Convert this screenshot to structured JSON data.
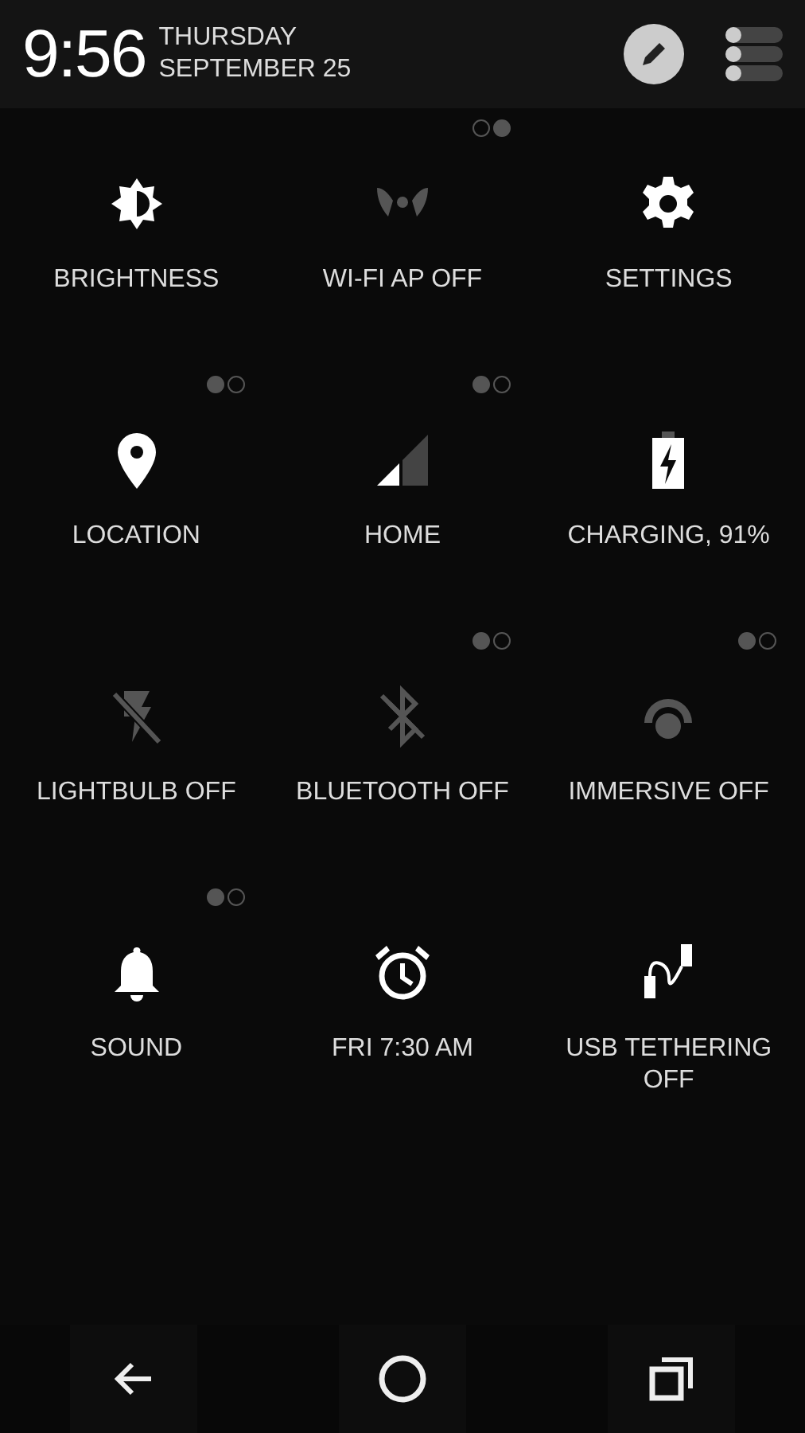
{
  "header": {
    "time": "9:56",
    "day": "THURSDAY",
    "date": "SEPTEMBER 25"
  },
  "tiles": [
    {
      "kind": "brightness",
      "label": "BRIGHTNESS",
      "on": true
    },
    {
      "kind": "hotspot",
      "label": "WI-FI AP OFF",
      "on": false,
      "page_dots": [
        {
          "selected": false
        },
        {
          "selected": true
        }
      ]
    },
    {
      "kind": "settings",
      "label": "SETTINGS",
      "on": true
    },
    {
      "kind": "location",
      "label": "LOCATION",
      "on": true,
      "page_dots": [
        {
          "selected": true
        },
        {
          "selected": false
        }
      ]
    },
    {
      "kind": "signal",
      "label": "HOME",
      "on": true,
      "page_dots": [
        {
          "selected": true
        },
        {
          "selected": false
        }
      ]
    },
    {
      "kind": "battery",
      "label": "CHARGING, 91%",
      "on": true
    },
    {
      "kind": "flash",
      "label": "LIGHTBULB OFF",
      "on": false
    },
    {
      "kind": "bluetooth",
      "label": "BLUETOOTH OFF",
      "on": false,
      "page_dots": [
        {
          "selected": true
        },
        {
          "selected": false
        }
      ]
    },
    {
      "kind": "immersive",
      "label": "IMMERSIVE OFF",
      "on": false,
      "page_dots": [
        {
          "selected": true
        },
        {
          "selected": false
        }
      ]
    },
    {
      "kind": "sound",
      "label": "SOUND",
      "on": true,
      "page_dots": [
        {
          "selected": true
        },
        {
          "selected": false
        }
      ]
    },
    {
      "kind": "alarm",
      "label": "FRI 7:30 AM",
      "on": true
    },
    {
      "kind": "usb",
      "label": "USB TETHERING OFF",
      "on": true
    }
  ]
}
